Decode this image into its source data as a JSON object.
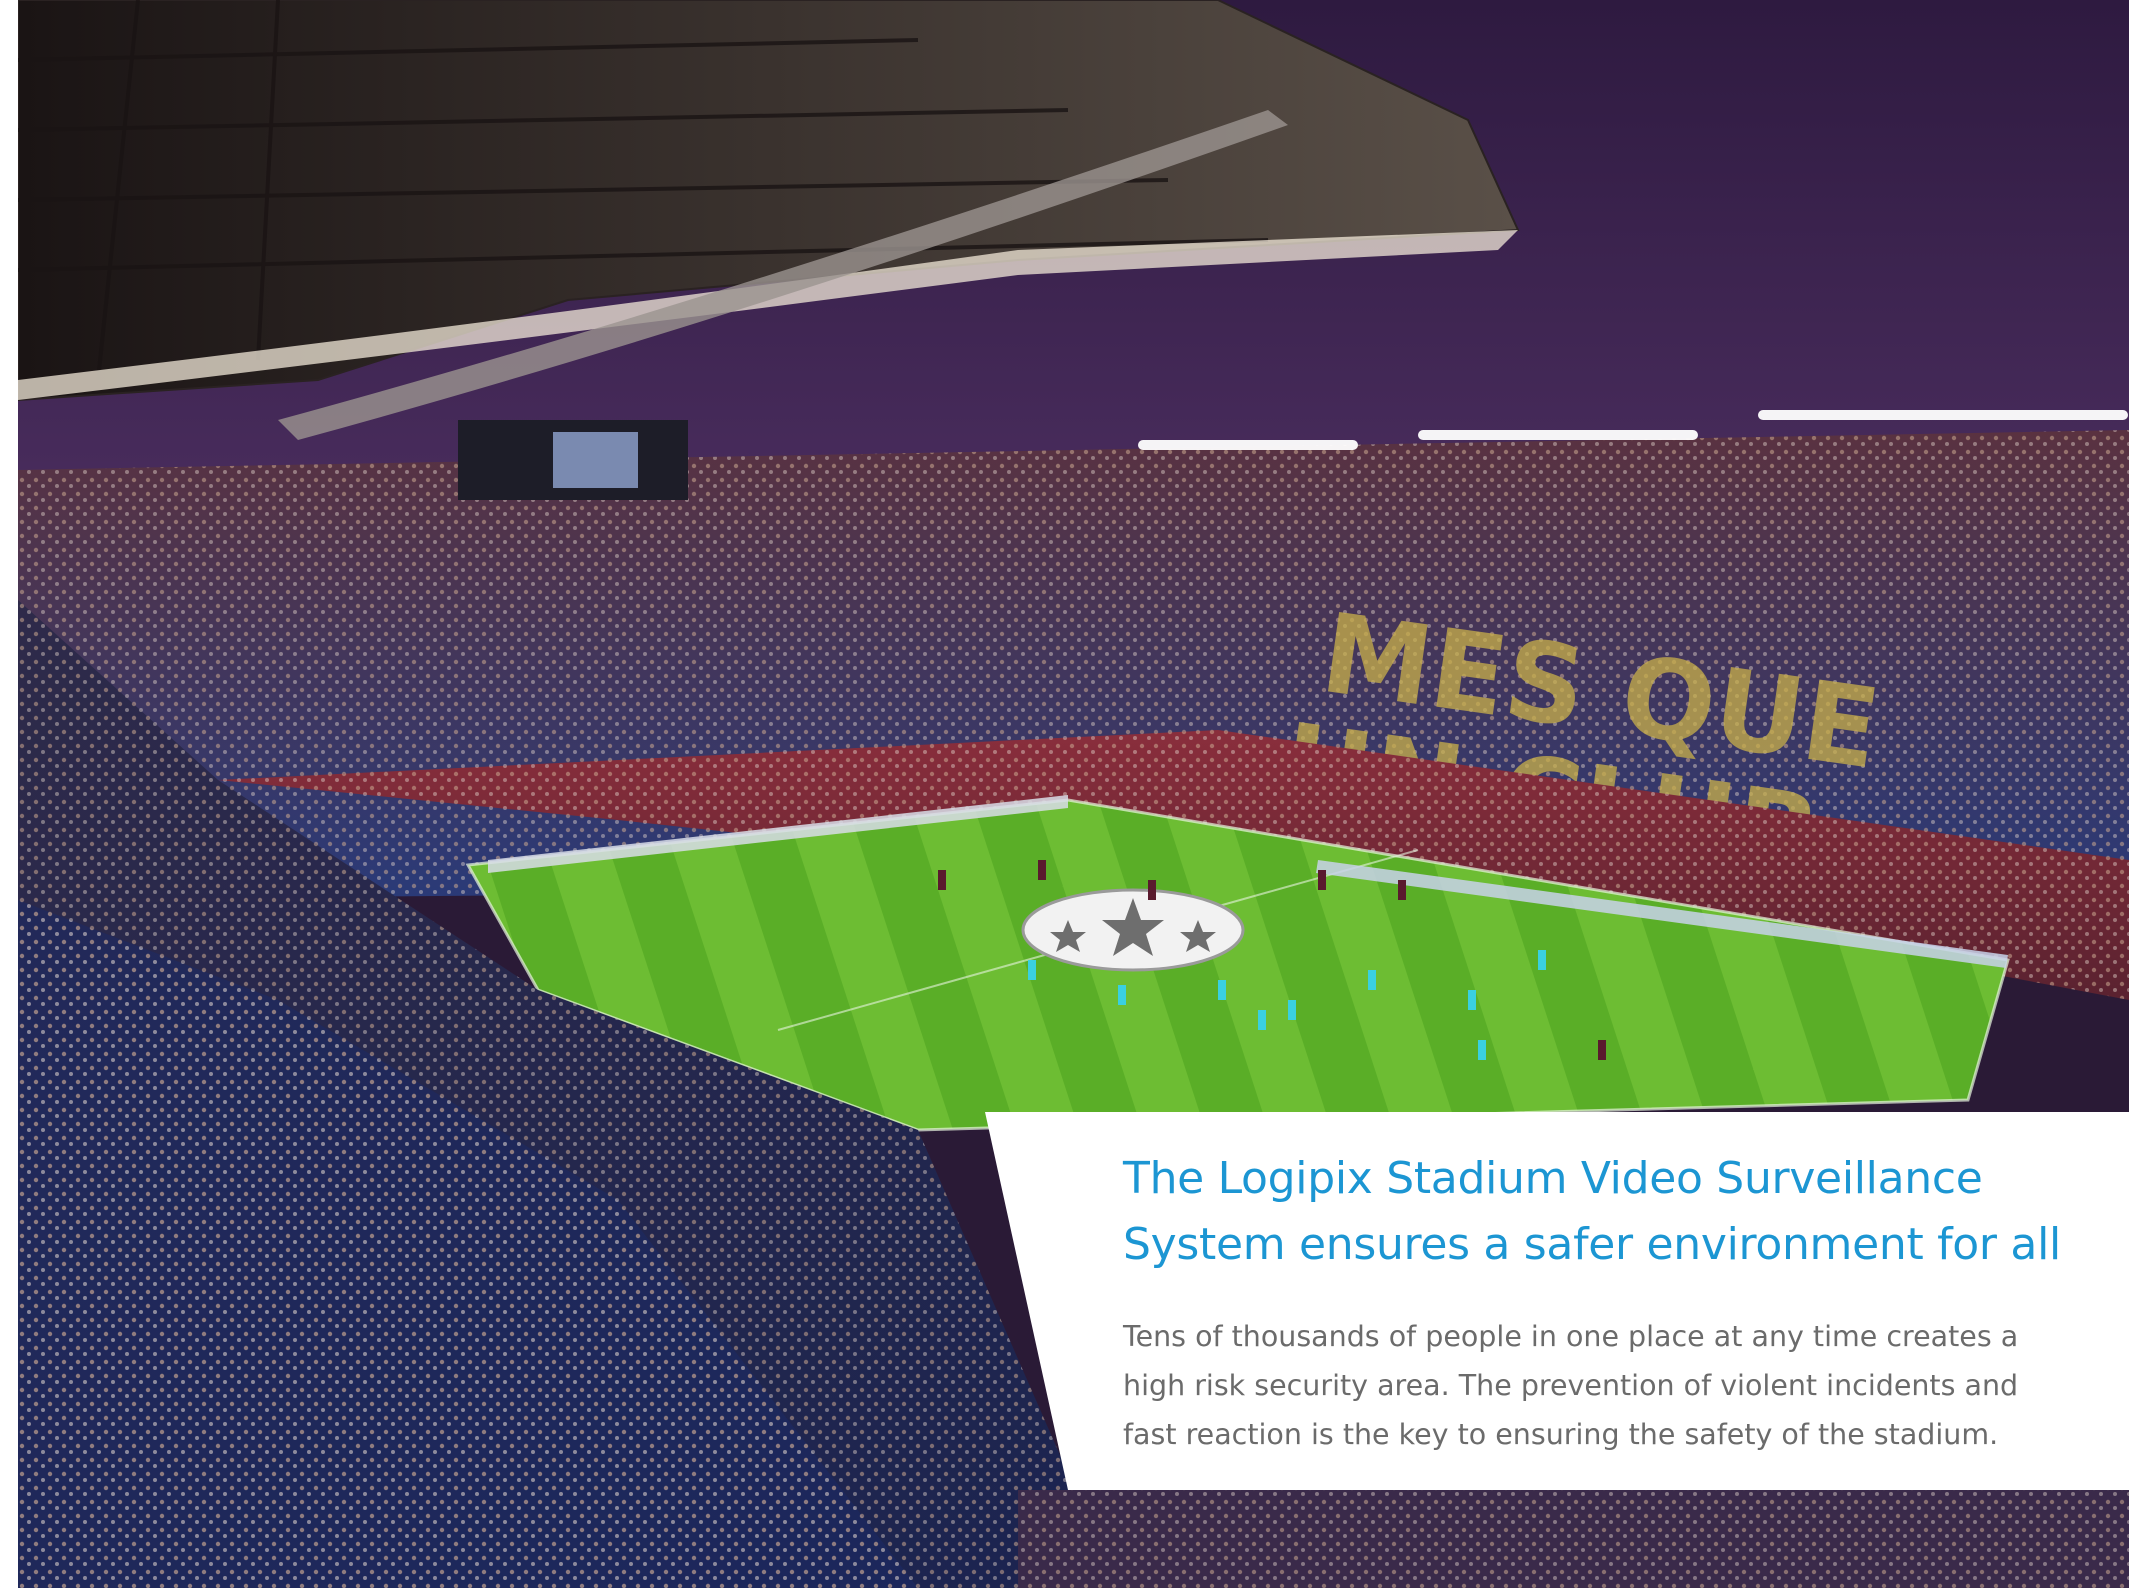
{
  "feature": {
    "title": "The Logipix Stadium Video Surveillance System ensures a safer environment for all",
    "body": "Tens of thousands of people in one place at any time creates a high risk security area. The prevention of violent incidents and fast reaction is the key to ensuring the safety of the stadium.",
    "title_color": "#1c96d3",
    "body_color": "#6b6b6b",
    "card_background": "#ffffff"
  },
  "photo": {
    "icon": "stadium-photo-icon",
    "sky_color": "#3a2250",
    "pitch_color": "#5fb52e",
    "seat_blue": "#1f3a8a",
    "seat_red": "#8c2a3a"
  }
}
